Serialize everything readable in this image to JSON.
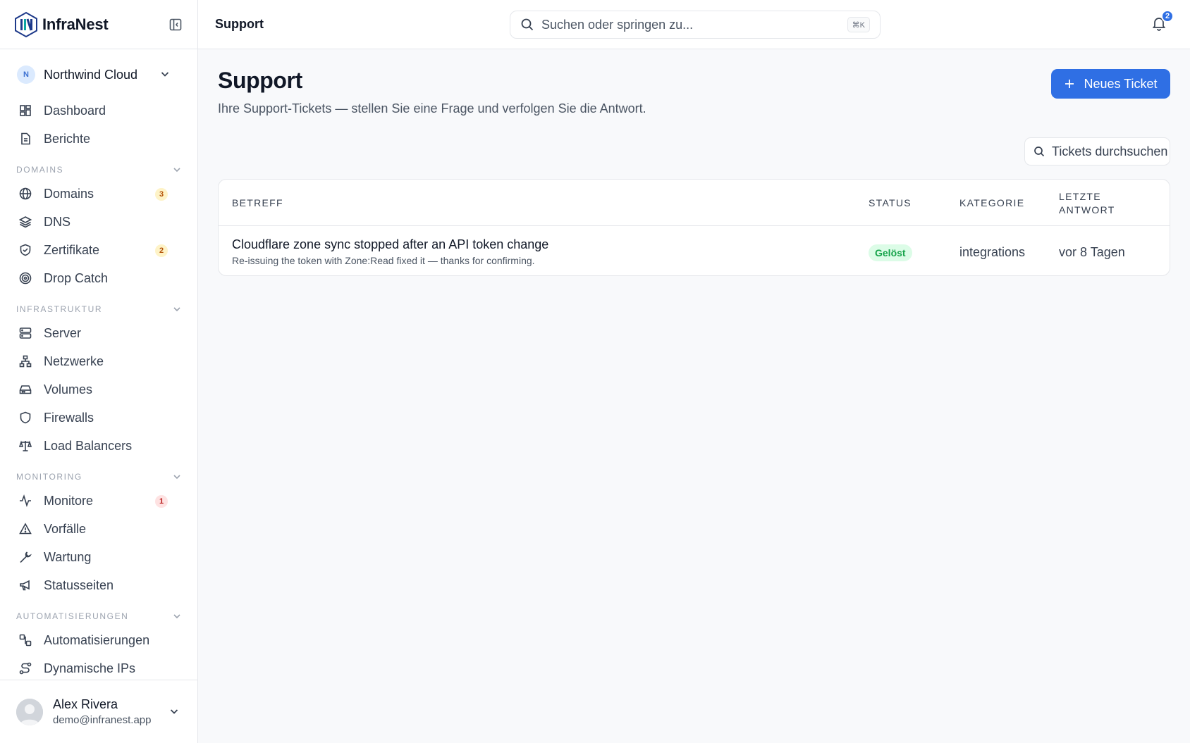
{
  "brand": {
    "name": "InfraNest"
  },
  "org": {
    "initial": "N",
    "name": "Northwind Cloud"
  },
  "nav": {
    "dashboard": "Dashboard",
    "berichte": "Berichte",
    "sections": {
      "domains": "DOMAINS",
      "infrastruktur": "INFRASTRUKTUR",
      "monitoring": "MONITORING",
      "automatisierungen": "AUTOMATISIERUNGEN"
    },
    "domains": {
      "label": "Domains",
      "badge": "3"
    },
    "dns": "DNS",
    "zertifikate": {
      "label": "Zertifikate",
      "badge": "2"
    },
    "drop_catch": "Drop Catch",
    "server": "Server",
    "netzwerke": "Netzwerke",
    "volumes": "Volumes",
    "firewalls": "Firewalls",
    "load_balancers": "Load Balancers",
    "monitore": {
      "label": "Monitore",
      "badge": "1"
    },
    "vorfaelle": "Vorfälle",
    "wartung": "Wartung",
    "statusseiten": "Statusseiten",
    "automatisierungen": "Automatisierungen",
    "dynamische_ips": "Dynamische IPs"
  },
  "user": {
    "name": "Alex Rivera",
    "email": "demo@infranest.app"
  },
  "topbar": {
    "title": "Support",
    "search_placeholder": "Suchen oder springen zu...",
    "shortcut": "⌘K",
    "notification_count": "2"
  },
  "page": {
    "title": "Support",
    "subtitle": "Ihre Support-Tickets — stellen Sie eine Frage und verfolgen Sie die Antwort.",
    "new_ticket_label": "Neues Ticket",
    "ticket_search_placeholder": "Tickets durchsuchen"
  },
  "table": {
    "headers": {
      "subject": "BETREFF",
      "status": "STATUS",
      "category": "KATEGORIE",
      "last_reply_1": "LETZTE",
      "last_reply_2": "ANTWORT"
    },
    "rows": [
      {
        "subject": "Cloudflare zone sync stopped after an API token change",
        "preview": "Re-issuing the token with Zone:Read fixed it — thanks for confirming.",
        "status": "Gelöst",
        "category": "integrations",
        "last_reply": "vor 8 Tagen"
      }
    ]
  },
  "colors": {
    "accent": "#2f6fe4",
    "status_resolved_bg": "#dcfce7",
    "status_resolved_fg": "#16a34a",
    "badge_amber": "#b45309",
    "badge_red": "#b91c1c"
  },
  "icons": {
    "logo": "infranest-logo",
    "collapse": "sidebar-collapse-icon",
    "search": "search-icon",
    "bell": "bell-icon"
  }
}
